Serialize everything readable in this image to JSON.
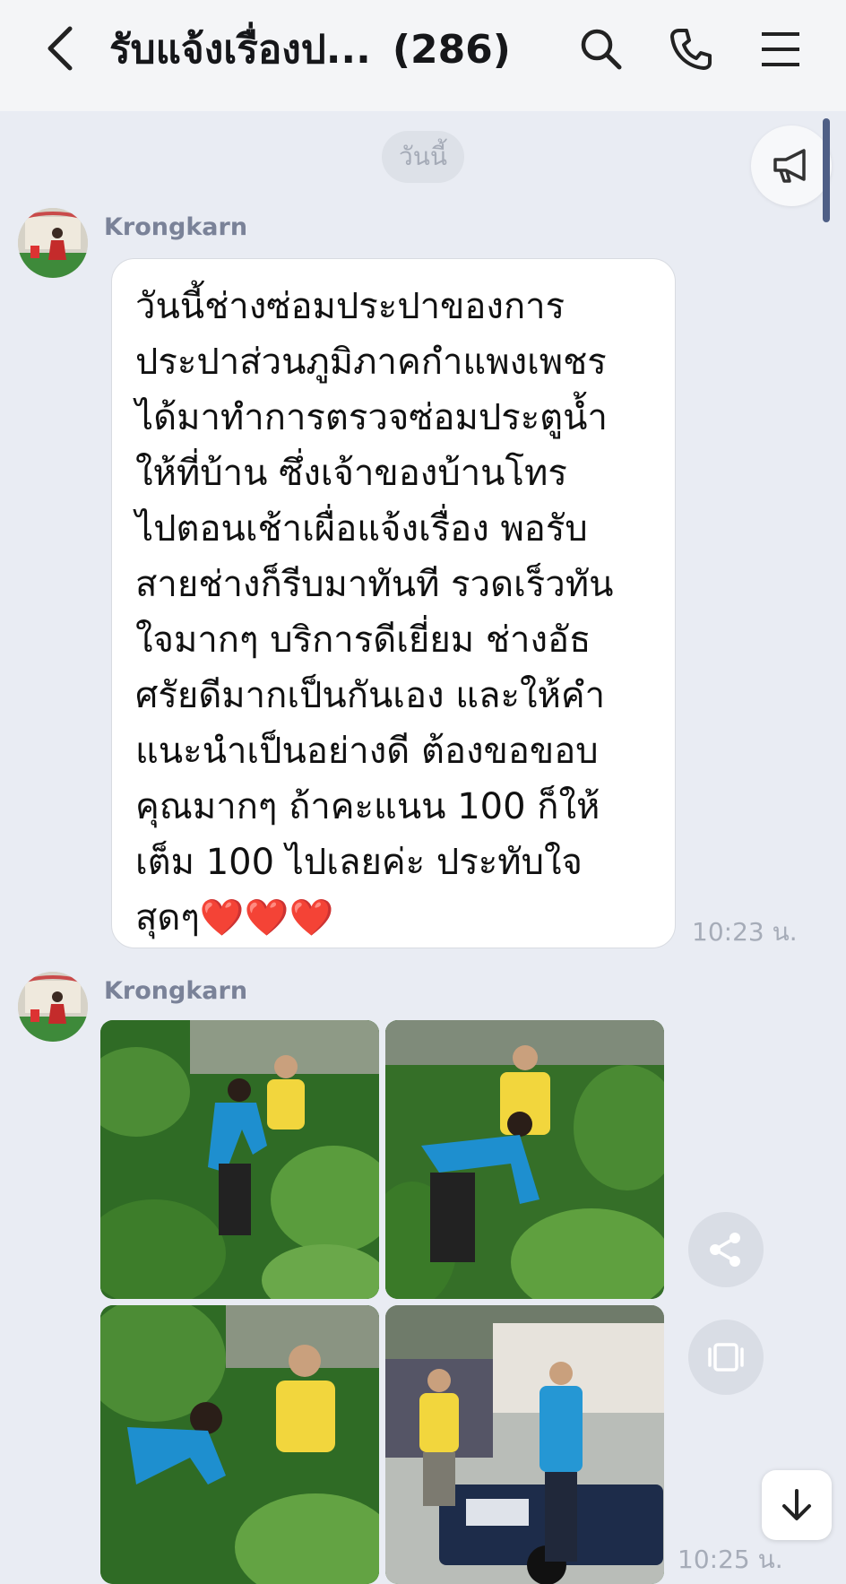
{
  "header": {
    "title": "รับแจ้งเรื่องป...",
    "member_count": "(286)"
  },
  "chat": {
    "date_divider": "วันนี้",
    "messages": [
      {
        "sender": "Krongkarn",
        "lines": [
          "วันนี้ช่างซ่อมประปาของการ",
          "ประปาส่วนภูมิภาคกำแพงเพชร",
          "ได้มาทำการตรวจซ่อมประตูน้ำ",
          "ให้ที่บ้าน ซึ่งเจ้าของบ้านโทร",
          "ไปตอนเช้าเผื่อแจ้งเรื่อง พอรับ",
          "สายช่างก็รีบมาทันที รวดเร็วทัน",
          "ใจมากๆ บริการดีเยี่ยม  ช่างอัธ",
          "ศรัยดีมากเป็นกันเอง และให้คำ",
          "แนะนำเป็นอย่างดี  ต้องขอขอบ",
          "คุณมากๆ ถ้าคะแนน 100 ก็ให้",
          "เต็ม 100 ไปเลยค่ะ ประทับใจ",
          "สุดๆ"
        ],
        "hearts": "❤️❤️❤️",
        "time": "10:23 น."
      },
      {
        "sender": "Krongkarn",
        "photo_count": 4,
        "time": "10:25 น."
      }
    ]
  },
  "icons": {
    "back": "chevron-left-icon",
    "search": "search-icon",
    "call": "phone-icon",
    "menu": "menu-icon",
    "announce": "megaphone-icon",
    "share": "share-icon",
    "album": "album-icon",
    "scroll_down": "arrow-down-icon"
  },
  "colors": {
    "background": "#e9ecf3",
    "header": "#f4f5f7",
    "bubble": "#ffffff",
    "sender": "#7a8298",
    "timestamp": "#a6acb8",
    "heart": "#e0242c"
  }
}
